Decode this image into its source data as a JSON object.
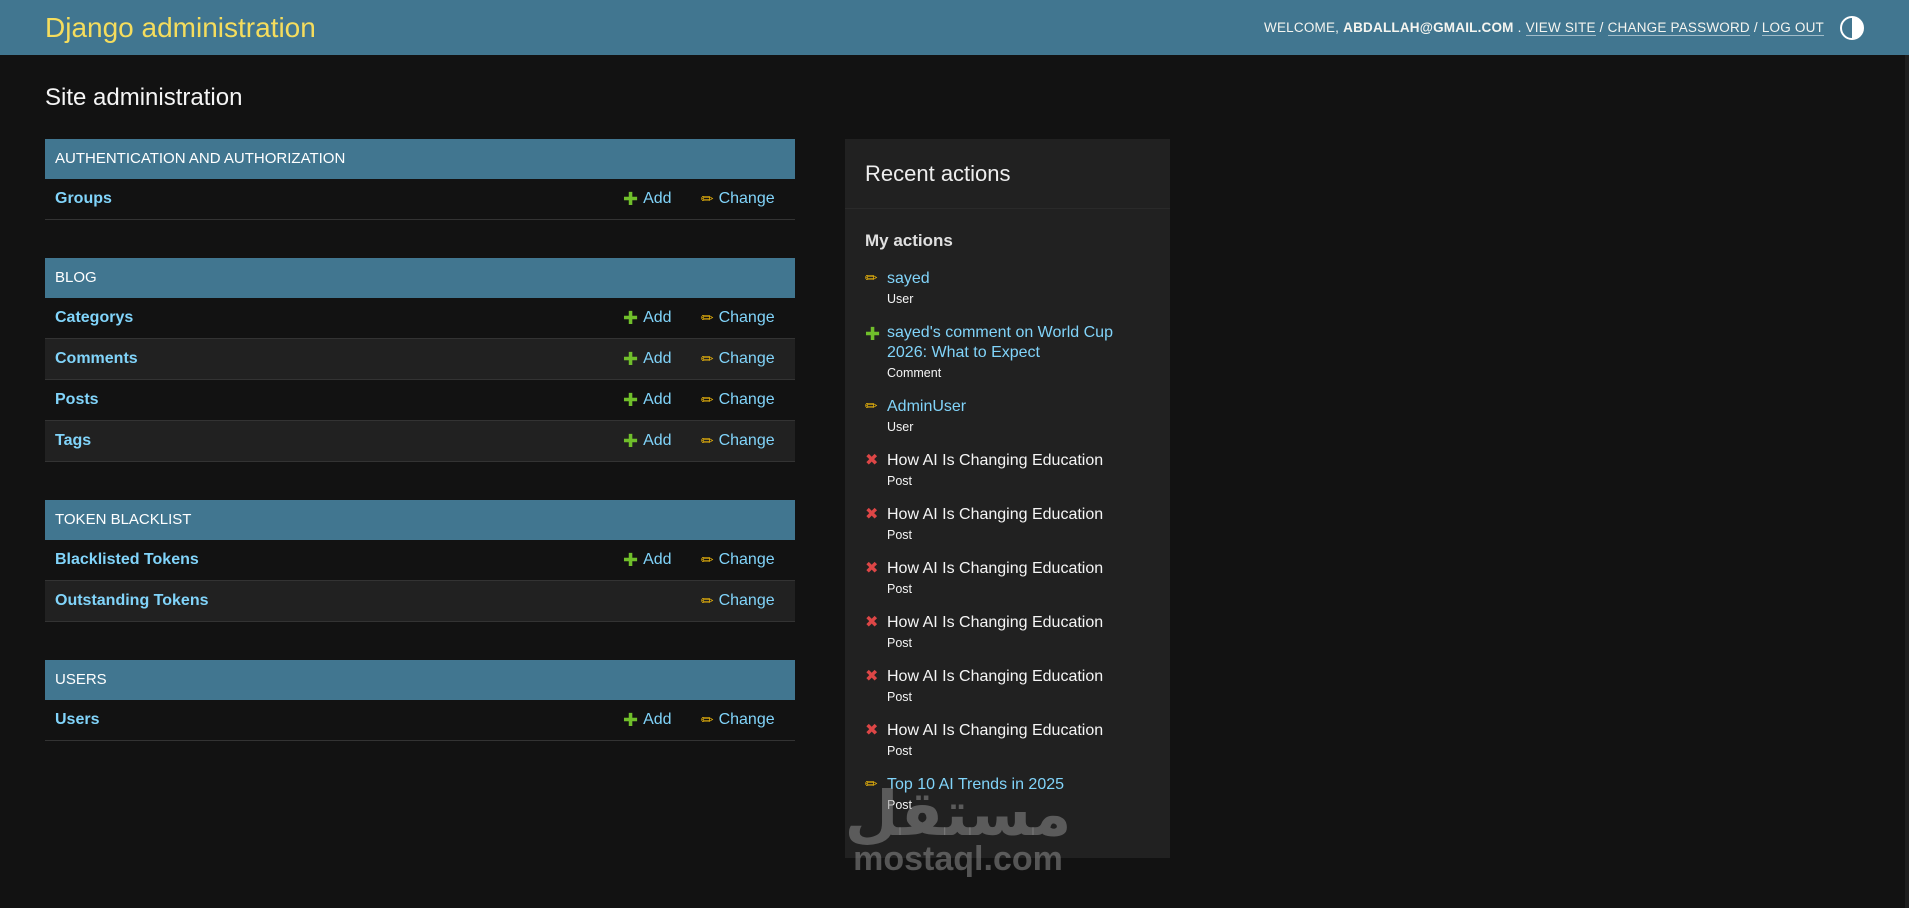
{
  "header": {
    "title": "Django administration",
    "welcome": "Welcome,",
    "user": "abdallah@gmail.com",
    "dot": ".",
    "view_site": "View site",
    "sep": "/",
    "change_password": "Change password",
    "log_out": "Log out"
  },
  "page_title": "Site administration",
  "modules": [
    {
      "caption": "Authentication and Authorization",
      "rows": [
        {
          "name": "Groups",
          "add": "Add",
          "change": "Change"
        }
      ]
    },
    {
      "caption": "Blog",
      "rows": [
        {
          "name": "Categorys",
          "add": "Add",
          "change": "Change"
        },
        {
          "name": "Comments",
          "add": "Add",
          "change": "Change"
        },
        {
          "name": "Posts",
          "add": "Add",
          "change": "Change"
        },
        {
          "name": "Tags",
          "add": "Add",
          "change": "Change"
        }
      ]
    },
    {
      "caption": "Token Blacklist",
      "rows": [
        {
          "name": "Blacklisted Tokens",
          "add": "Add",
          "change": "Change"
        },
        {
          "name": "Outstanding Tokens",
          "add": null,
          "change": "Change"
        }
      ]
    },
    {
      "caption": "Users",
      "rows": [
        {
          "name": "Users",
          "add": "Add",
          "change": "Change"
        }
      ]
    }
  ],
  "recent": {
    "title": "Recent actions",
    "subtitle": "My actions",
    "items": [
      {
        "icon": "pencil",
        "title": "sayed",
        "type": "User"
      },
      {
        "icon": "plus",
        "title": "sayed's comment on World Cup 2026: What to Expect",
        "type": "Comment"
      },
      {
        "icon": "pencil",
        "title": "AdminUser",
        "type": "User"
      },
      {
        "icon": "x",
        "title": "How AI Is Changing Education",
        "type": "Post"
      },
      {
        "icon": "x",
        "title": "How AI Is Changing Education",
        "type": "Post"
      },
      {
        "icon": "x",
        "title": "How AI Is Changing Education",
        "type": "Post"
      },
      {
        "icon": "x",
        "title": "How AI Is Changing Education",
        "type": "Post"
      },
      {
        "icon": "x",
        "title": "How AI Is Changing Education",
        "type": "Post"
      },
      {
        "icon": "x",
        "title": "How AI Is Changing Education",
        "type": "Post"
      },
      {
        "icon": "pencil",
        "title": "Top 10 AI Trends in 2025",
        "type": "Post"
      }
    ]
  },
  "watermark": {
    "arabic": "مستقل",
    "latin": "mostaql.com"
  },
  "colors": {
    "header": "#417690",
    "brand": "#f5dd5d",
    "link": "#81d4fa",
    "add": "#70bf2b",
    "change": "#efb80b",
    "delete": "#dd4646"
  }
}
